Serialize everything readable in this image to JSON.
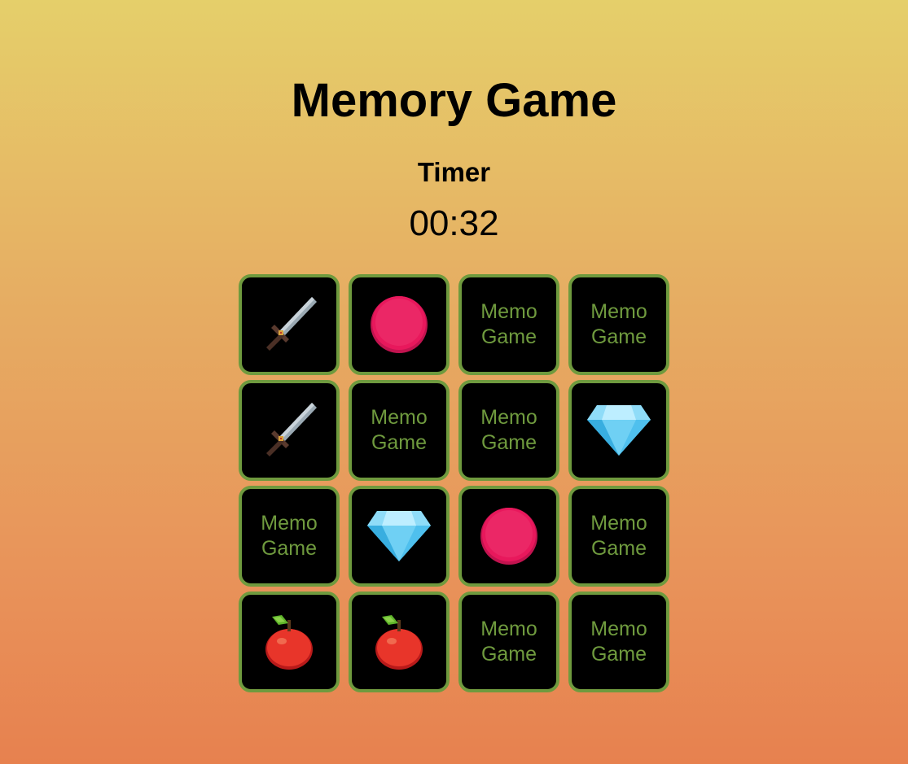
{
  "header": {
    "title": "Memory Game",
    "timer_label": "Timer",
    "timer_value": "00:32"
  },
  "colors": {
    "card_back": "#000000",
    "card_border": "#6f9a3e",
    "card_text": "#6f9a3e"
  },
  "board": {
    "cards": [
      {
        "state": "revealed",
        "icon": "sword-icon"
      },
      {
        "state": "revealed",
        "icon": "pink-orb-icon"
      },
      {
        "state": "hidden",
        "text": "Memo\nGame"
      },
      {
        "state": "hidden",
        "text": "Memo\nGame"
      },
      {
        "state": "revealed",
        "icon": "sword-icon"
      },
      {
        "state": "hidden",
        "text": "Memo\nGame"
      },
      {
        "state": "hidden",
        "text": "Memo\nGame"
      },
      {
        "state": "revealed",
        "icon": "diamond-icon"
      },
      {
        "state": "hidden",
        "text": "Memo\nGame"
      },
      {
        "state": "revealed",
        "icon": "diamond-icon"
      },
      {
        "state": "revealed",
        "icon": "pink-orb-icon"
      },
      {
        "state": "hidden",
        "text": "Memo\nGame"
      },
      {
        "state": "revealed",
        "icon": "apple-icon"
      },
      {
        "state": "revealed",
        "icon": "apple-icon"
      },
      {
        "state": "hidden",
        "text": "Memo\nGame"
      },
      {
        "state": "hidden",
        "text": "Memo\nGame"
      }
    ]
  }
}
